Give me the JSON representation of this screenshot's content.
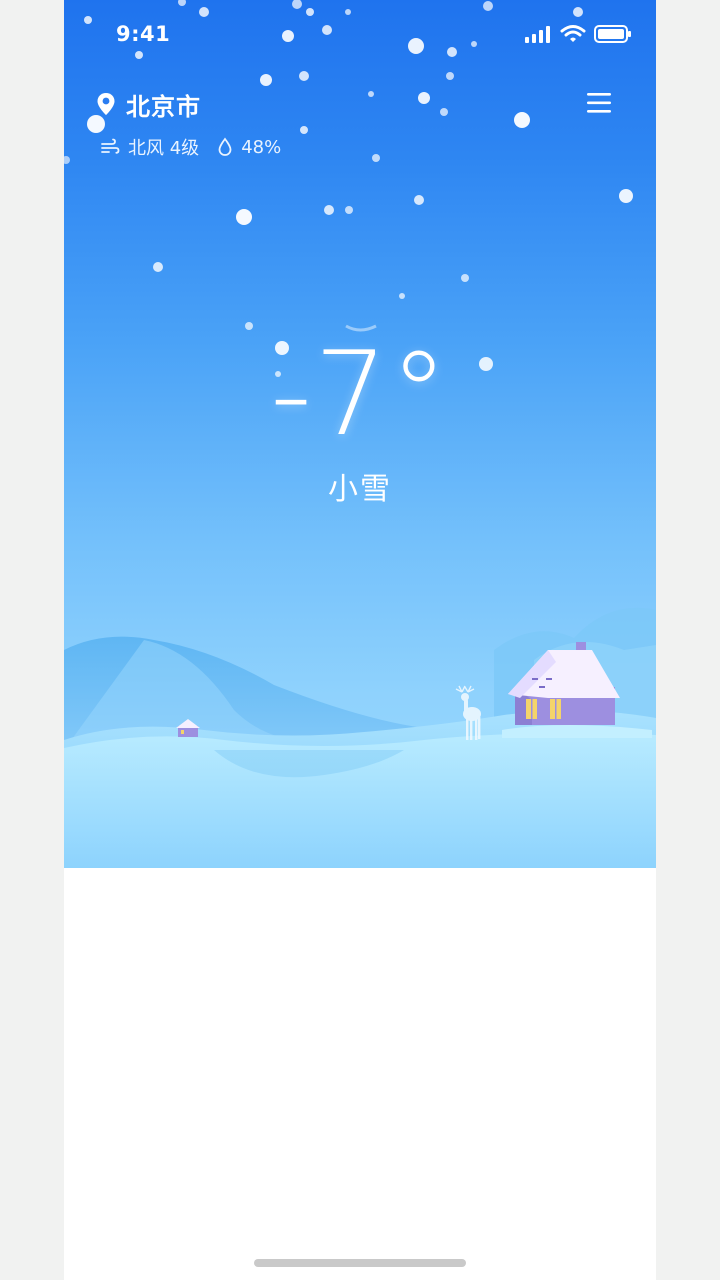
{
  "status_bar": {
    "time": "9:41"
  },
  "location": {
    "city": "北京市",
    "icon": "location-pin-icon"
  },
  "details": {
    "wind": "北风 4级",
    "humidity": "48%",
    "wind_icon": "wind-icon",
    "humidity_icon": "water-drop-icon"
  },
  "weather": {
    "temperature": "-7°",
    "condition": "小雪"
  },
  "colors": {
    "sky_top": "#1f73ee",
    "sky_bottom": "#9cdbfe",
    "house": "#9d8fe0",
    "roof_snow": "#f6f0ff"
  },
  "icons": {
    "menu": "menu-icon",
    "signal": "cellular-signal-icon",
    "wifi": "wifi-icon",
    "battery": "battery-icon"
  }
}
